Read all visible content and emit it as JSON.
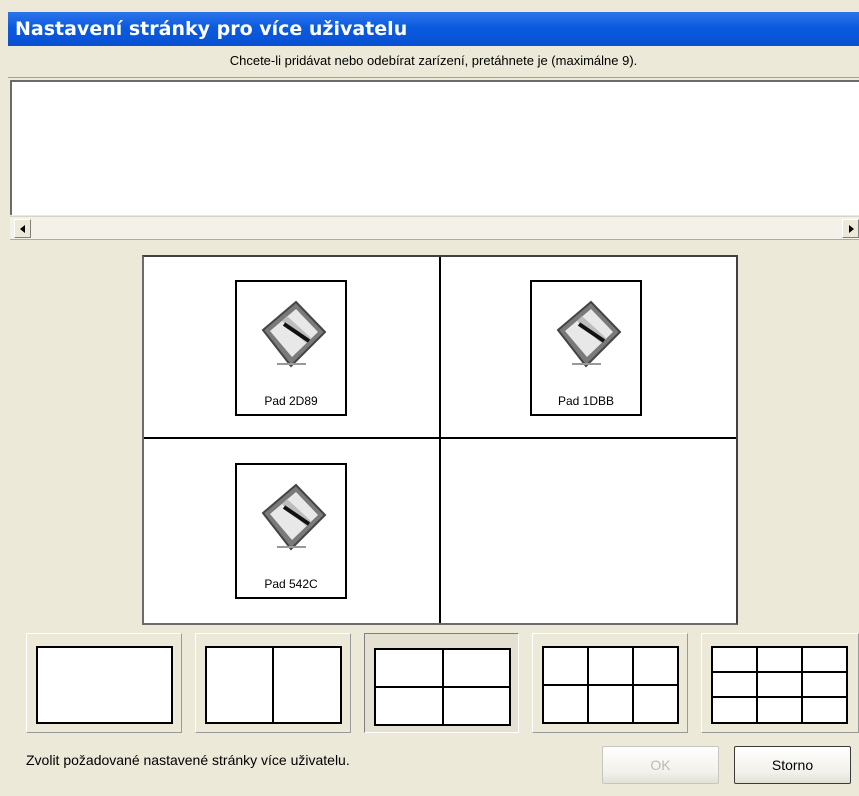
{
  "dialog": {
    "title": "Nastavení stránky pro více uživatelu",
    "instruction": "Chcete-li pridávat nebo odebírat zarízení, pretáhnete je (maximálne 9).",
    "status_text": "Zvolit požadované nastavené stránky více uživatelu.",
    "ok_label": "OK",
    "cancel_label": "Storno"
  },
  "devices": [
    {
      "label": "Pad 2D89",
      "icon": "tablet-pen-icon"
    },
    {
      "label": "Pad 1DBB",
      "icon": "tablet-pen-icon"
    },
    {
      "label": "Pad 542C",
      "icon": "tablet-pen-icon"
    }
  ],
  "layouts": [
    {
      "name": "1x1",
      "cols": 1,
      "rows": 1
    },
    {
      "name": "2x1",
      "cols": 2,
      "rows": 1
    },
    {
      "name": "2x2",
      "cols": 2,
      "rows": 2,
      "selected": true
    },
    {
      "name": "3x2",
      "cols": 3,
      "rows": 2
    },
    {
      "name": "3x3",
      "cols": 3,
      "rows": 3
    }
  ]
}
